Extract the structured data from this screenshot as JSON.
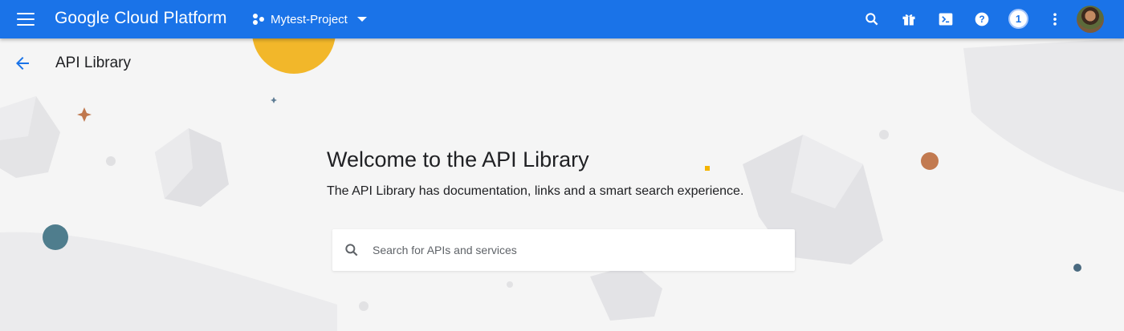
{
  "topbar": {
    "brand": "Google Cloud Platform",
    "project_name": "Mytest-Project",
    "notification_count": "1",
    "icons": [
      "menu-icon",
      "project-icon",
      "search-icon",
      "gift-icon",
      "cloud-shell-icon",
      "help-icon",
      "more-vert-icon"
    ]
  },
  "page": {
    "title": "API Library",
    "welcome_heading": "Welcome to the API Library",
    "welcome_subtitle": "The API Library has documentation, links and a smart search experience."
  },
  "search": {
    "placeholder": "Search for APIs and services"
  },
  "colors": {
    "topbar": "#1a73e8",
    "background": "#f5f5f5",
    "accent_yellow": "#f4b400",
    "accent_orange": "#c0784e",
    "accent_teal": "#4a7a8c"
  }
}
